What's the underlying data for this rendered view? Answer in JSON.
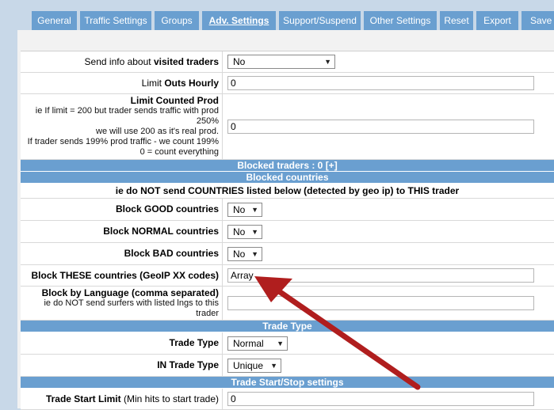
{
  "tabs": [
    "General",
    "Traffic Settings",
    "Groups",
    "Adv. Settings",
    "Support/Suspend",
    "Other Settings",
    "Reset",
    "Export",
    "Save I"
  ],
  "active_tab": "Adv. Settings",
  "rows": {
    "visited_pre": "Send info about ",
    "visited_bold": "visited traders",
    "visited_value": "No",
    "outs_pre": "Limit ",
    "outs_bold": "Outs Hourly",
    "outs_value": "0",
    "prod_title": "Limit Counted Prod",
    "prod_l1": "ie If limit = 200 but trader sends traffic with prod",
    "prod_l2": "250%",
    "prod_l3": "we will use 200 as it's real prod.",
    "prod_l4": "If trader sends 199% prod traffic - we count 199%",
    "prod_l5": "0 = count everything",
    "prod_value": "0"
  },
  "headers": {
    "blocked_traders": "Blocked traders : 0 [+]",
    "blocked_countries": "Blocked countries",
    "countries_note": "ie do NOT send COUNTRIES listed below (detected by geo ip) to THIS trader",
    "trade_type": "Trade Type",
    "trade_start_stop": "Trade Start/Stop settings"
  },
  "countries": {
    "good_label": "Block GOOD countries",
    "good_value": "No",
    "normal_label": "Block NORMAL countries",
    "normal_value": "No",
    "bad_label": "Block BAD countries",
    "bad_value": "No",
    "these_label": "Block THESE countries (GeoIP XX codes)",
    "these_value": "Array",
    "lang_label": "Block by Language (comma separated)",
    "lang_l1": "ie do NOT send surfers with listed lngs to this",
    "lang_l2": "trader",
    "lang_value": ""
  },
  "trade": {
    "type_label": "Trade Type",
    "type_value": "Normal",
    "in_label": "IN Trade Type",
    "in_value": "Unique",
    "start_bold": "Trade Start Limit",
    "start_rest": " (Min hits to start trade)",
    "start_value": "0"
  },
  "colors": {
    "tab_bg": "#6a9fd0",
    "arrow": "#b01e1e"
  }
}
